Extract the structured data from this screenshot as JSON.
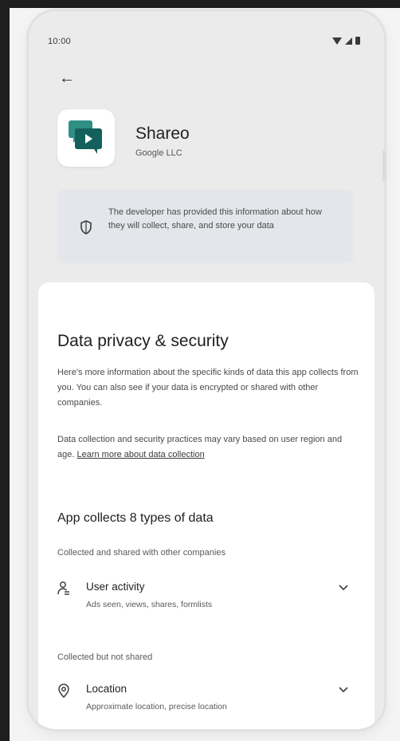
{
  "status_bar": {
    "time": "10:00"
  },
  "app": {
    "name": "Shareo",
    "developer": "Google LLC",
    "icon_color": "#14605c"
  },
  "info_card": {
    "text": "The developer has provided this information about how they will collect, share, and store your data"
  },
  "privacy": {
    "title": "Data privacy & security",
    "para1": "Here's more information about the specific kinds of data this app collects from you. You can also see if your data is encrypted or shared with other companies.",
    "para2_prefix": "Data collection and security practices may vary based on user region and age. ",
    "para2_link": "Learn more about data collection",
    "section_title": "App collects 8 types of data",
    "groups": [
      {
        "label": "Collected and shared with other companies",
        "items": [
          {
            "icon": "user-activity-icon",
            "title": "User activity",
            "subtitle": "Ads seen, views, shares, formlists"
          }
        ]
      },
      {
        "label": "Collected but not shared",
        "items": [
          {
            "icon": "location-icon",
            "title": "Location",
            "subtitle": "Approximate location, precise location"
          }
        ]
      }
    ]
  }
}
